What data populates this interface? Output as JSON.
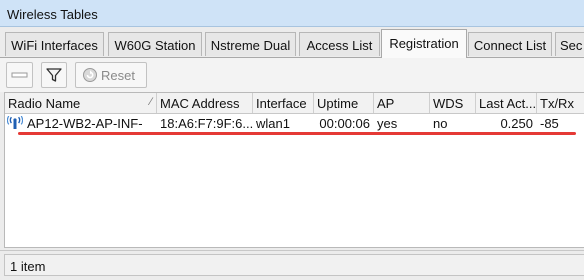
{
  "window": {
    "title": "Wireless Tables"
  },
  "tabs": [
    {
      "label": "WiFi Interfaces"
    },
    {
      "label": "W60G Station"
    },
    {
      "label": "Nstreme Dual"
    },
    {
      "label": "Access List"
    },
    {
      "label": "Registration",
      "active": true
    },
    {
      "label": "Connect List"
    },
    {
      "label": "Sec"
    }
  ],
  "toolbar": {
    "remove_icon": "minus-icon",
    "filter_icon": "filter-icon",
    "reset_icon": "reset-icon",
    "reset_label": "Reset"
  },
  "table": {
    "columns": [
      "Radio Name",
      "MAC Address",
      "Interface",
      "Uptime",
      "AP",
      "WDS",
      "Last Act...",
      "Tx/Rx"
    ],
    "rows": [
      {
        "icon": "wireless-client-icon",
        "radio_name": "AP12-WB2-AP-INF-",
        "mac": "18:A6:F7:9F:6...",
        "interface": "wlan1",
        "uptime": "00:00:06",
        "ap": "yes",
        "wds": "no",
        "last_activity": "0.250",
        "txrx": "-85"
      }
    ]
  },
  "annotation": {
    "color": "#e53935"
  },
  "status": {
    "text": "1 item"
  }
}
